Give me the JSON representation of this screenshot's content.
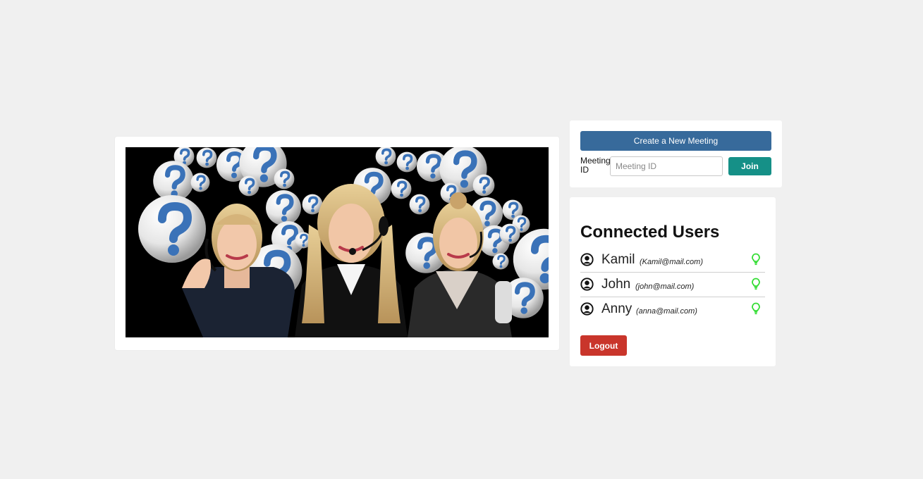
{
  "meeting": {
    "create_label": "Create a New Meeting",
    "id_label": "Meeting ID",
    "id_value": "",
    "id_placeholder": "Meeting ID",
    "join_label": "Join"
  },
  "users_panel": {
    "title": "Connected Users",
    "users": [
      {
        "name": "Kamil",
        "email": "(Kamil@mail.com)",
        "status_icon": "lightbulb-icon"
      },
      {
        "name": "John",
        "email": "(john@mail.com)",
        "status_icon": "lightbulb-icon"
      },
      {
        "name": "Anny",
        "email": "(anna@mail.com)",
        "status_icon": "lightbulb-icon"
      }
    ],
    "logout_label": "Logout"
  },
  "colors": {
    "create_button": "#376a9b",
    "join_button": "#159087",
    "logout_button": "#c9352b",
    "status_online": "#33dd33"
  },
  "hero": {
    "image_subject": "three smiling women wearing call-center headsets in front of question-mark bubbles"
  }
}
